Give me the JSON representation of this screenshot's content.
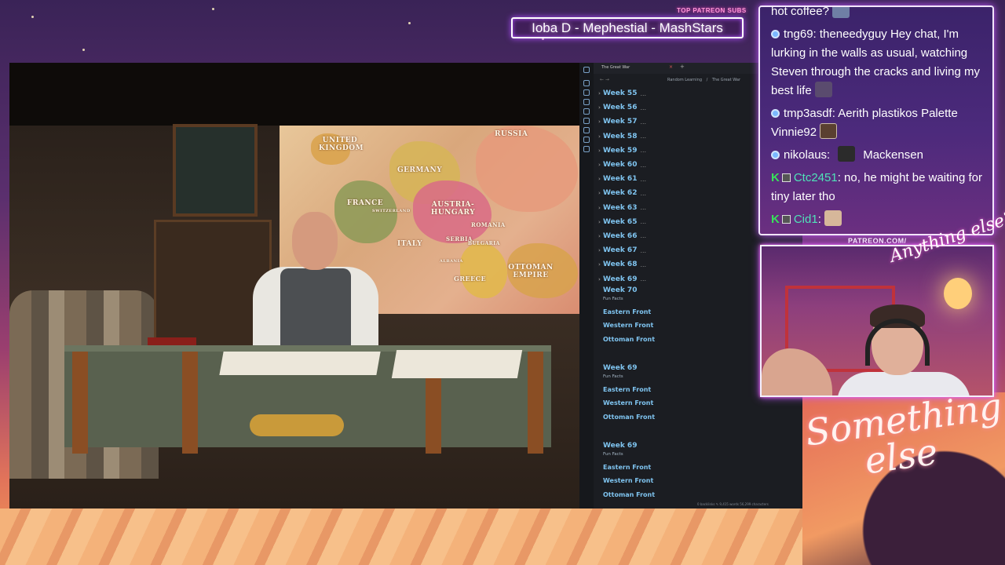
{
  "overlay": {
    "top_patreon_label": "TOP PATREON SUBS",
    "top_patreon_names": "Ioba D - Mephestial - MashStars",
    "patreon_url": "PATREON.COM/",
    "cam_sign": "Anything else?",
    "brand_line1": "Something",
    "brand_line2": "else"
  },
  "video": {
    "map_labels": {
      "united_kingdom": "UNITED KINGDOM",
      "france": "FRANCE",
      "germany": "GERMANY",
      "russia": "RUSSIA",
      "austria_hungary": "AUSTRIA-HUNGARY",
      "switzerland": "SWITZERLAND",
      "italy": "ITALY",
      "serbia": "SERBIA",
      "romania": "ROMANIA",
      "bulgaria": "BULGARIA",
      "albania": "ALBANIA",
      "greece": "GREECE",
      "ottoman_empire": "OTTOMAN EMPIRE"
    }
  },
  "notes": {
    "tab_title": "The Great War",
    "close_glyph": "×",
    "add_glyph": "+",
    "nav_arrows": "← →",
    "breadcrumb": [
      "Random Learning",
      "/",
      "The Great War"
    ],
    "weeks": [
      "Week 55",
      "Week 56",
      "Week 57",
      "Week 58",
      "Week 59",
      "Week 60",
      "Week 61",
      "Week 62",
      "Week 63",
      "Week 65",
      "Week 66",
      "Week 67",
      "Week 68",
      "Week 69"
    ],
    "collapse_glyph": "›",
    "ellipsis": "...",
    "sections": [
      {
        "title": "Week 70",
        "subtitle": "Fun Facts",
        "links": [
          "Eastern Front",
          "Western Front",
          "Ottoman Front"
        ]
      },
      {
        "title": "Week 69",
        "subtitle": "Fun Facts",
        "links": [
          "Eastern Front",
          "Western Front",
          "Ottoman Front"
        ]
      },
      {
        "title": "Week 69",
        "subtitle": "Fun Facts",
        "links": [
          "Eastern Front",
          "Western Front",
          "Ottoman Front"
        ]
      }
    ],
    "status": "0 backlinks   ✎   9,415 words   56,299 characters"
  },
  "chat": {
    "messages": [
      {
        "text": "hot coffee?"
      },
      {
        "user": "tng69",
        "text": ": theneedyguy Hey chat, I'm lurking in the walls as usual, watching Steven through the cracks and living my best life"
      },
      {
        "user": "tmp3asdf",
        "text": ": Aerith plastikos Palette Vinnie92"
      },
      {
        "user": "nikolaus",
        "text": ":",
        "after": "Mackensen"
      },
      {
        "user": "Ctc2451",
        "text": ": no, he might be waiting for tiny later tho"
      },
      {
        "user": "Cid1",
        "text": ":"
      }
    ],
    "badge_k": "K"
  },
  "colors": {
    "accent_link": "#7fc4f0",
    "chat_border_glow": "#c45bff",
    "mod_green": "#38e05a"
  }
}
